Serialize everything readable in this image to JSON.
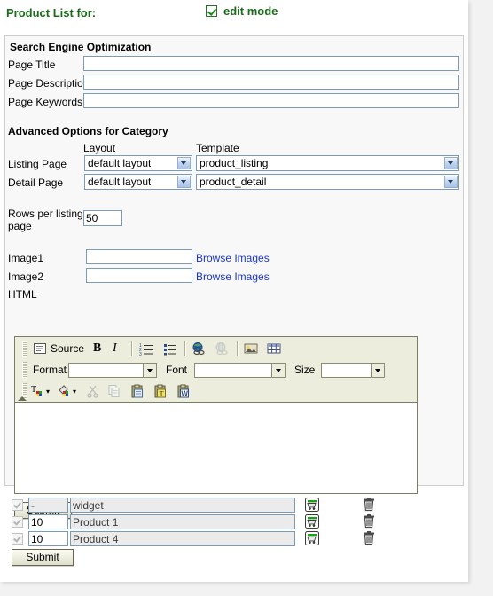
{
  "header": {
    "title": "Product List for:",
    "edit_mode_label": "edit mode",
    "edit_mode_checked": true,
    "title_color": "#1a6b1a"
  },
  "seo": {
    "heading": "Search Engine Optimization",
    "fields": [
      {
        "label": "Page Title",
        "value": "",
        "placeholder": ""
      },
      {
        "label": "Page Description",
        "value": "",
        "placeholder": ""
      },
      {
        "label": "Page Keywords",
        "value": "",
        "placeholder": ""
      }
    ]
  },
  "advanced": {
    "heading": "Advanced Options for Category",
    "col_layout": "Layout",
    "col_template": "Template",
    "rows": [
      {
        "label": "Listing Page",
        "layout": "default layout",
        "template": "product_listing"
      },
      {
        "label": "Detail Page",
        "layout": "default layout",
        "template": "product_detail"
      }
    ],
    "rows_per_page_label_line1": "Rows per listing",
    "rows_per_page_label_line2": "page",
    "rows_per_page_value": "50"
  },
  "images": {
    "image1_label": "Image1",
    "image1_value": "",
    "image1_browse": "Browse Images",
    "image2_label": "Image2",
    "image2_value": "",
    "image2_browse": "Browse Images"
  },
  "html_editor": {
    "label": "HTML",
    "toolbar_row1": [
      {
        "name": "source-button",
        "label": "Source"
      },
      {
        "name": "bold-button",
        "label": "B"
      },
      {
        "name": "italic-button",
        "label": "I"
      },
      {
        "name": "numbered-list-button",
        "label": ""
      },
      {
        "name": "bulleted-list-button",
        "label": ""
      },
      {
        "name": "link-button",
        "label": ""
      },
      {
        "name": "unlink-button",
        "label": ""
      },
      {
        "name": "image-button",
        "label": ""
      },
      {
        "name": "table-button",
        "label": ""
      }
    ],
    "format_label": "Format",
    "format_value": "",
    "font_label": "Font",
    "font_value": "",
    "size_label": "Size",
    "size_value": "",
    "toolbar_row3": [
      {
        "name": "text-color-button",
        "label": ""
      },
      {
        "name": "background-color-button",
        "label": ""
      },
      {
        "name": "cut-button",
        "label": ""
      },
      {
        "name": "copy-button",
        "label": ""
      },
      {
        "name": "paste-button",
        "label": ""
      },
      {
        "name": "paste-text-button",
        "label": ""
      },
      {
        "name": "paste-word-button",
        "label": ""
      }
    ],
    "body_value": ""
  },
  "submit_top": "Submit",
  "submit_bottom": "Submit",
  "product_list": {
    "rows": [
      {
        "checked": true,
        "order": "-",
        "name": "widget",
        "order_muted": true
      },
      {
        "checked": true,
        "order": "10",
        "name": "Product 1",
        "order_muted": false
      },
      {
        "checked": true,
        "order": "10",
        "name": "Product 4",
        "order_muted": false
      }
    ]
  },
  "colors": {
    "page_bg": "#f2f2f2",
    "sheet_bg": "#ffffff",
    "panel_bg": "#f8f8f8",
    "toolbar_bg": "#eceddd",
    "link": "#1a35c8",
    "accent_green": "#1a6b1a"
  }
}
